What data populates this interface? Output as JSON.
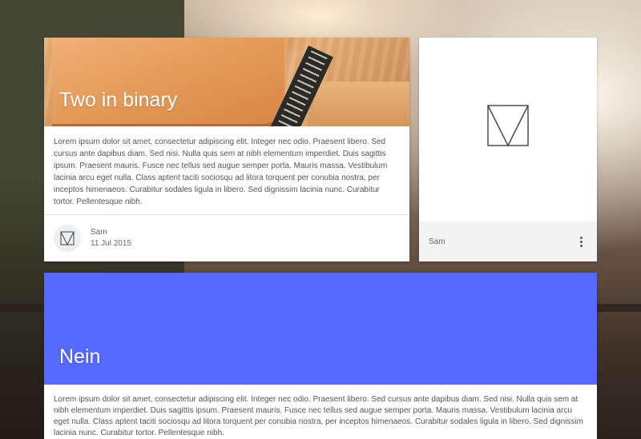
{
  "cards": [
    {
      "title": "Two in binary",
      "body": "Lorem ipsum dolor sit amet, consectetur adipiscing elit. Integer nec odio. Praesent libero. Sed cursus ante dapibus diam. Sed nisi. Nulla quis sem at nibh elementum imperdiet. Duis sagittis ipsum. Praesent mauris. Fusce nec tellus sed augue semper porta. Mauris massa. Vestibulum lacinia arcu eget nulla. Class aptent taciti sociosqu ad litora torquent per conubia nostra, per inceptos himenaeos. Curabitur sodales ligula in libero. Sed dignissim lacinia nunc. Curabitur tortor. Pellentesque nibh.",
      "author": "Sam",
      "date": "11 Jul 2015",
      "avatar_icon": "v-logo-icon"
    },
    {
      "logo_icon": "v-logo-icon",
      "author": "Sam",
      "menu_icon": "more-vertical-icon"
    },
    {
      "title": "Nein",
      "header_color": "#5569ff",
      "body": "Lorem ipsum dolor sit amet, consectetur adipiscing elit. Integer nec odio. Praesent libero. Sed cursus ante dapibus diam. Sed nisi. Nulla quis sem at nibh elementum imperdiet. Duis sagittis ipsum. Praesent mauris. Fusce nec tellus sed augue semper porta. Mauris massa. Vestibulum lacinia arcu eget nulla. Class aptent taciti sociosqu ad litora torquent per conubia nostra, per inceptos himenaeos. Curabitur sodales ligula in libero. Sed dignissim lacinia nunc. Curabitur tortor. Pellentesque nibh."
    }
  ]
}
